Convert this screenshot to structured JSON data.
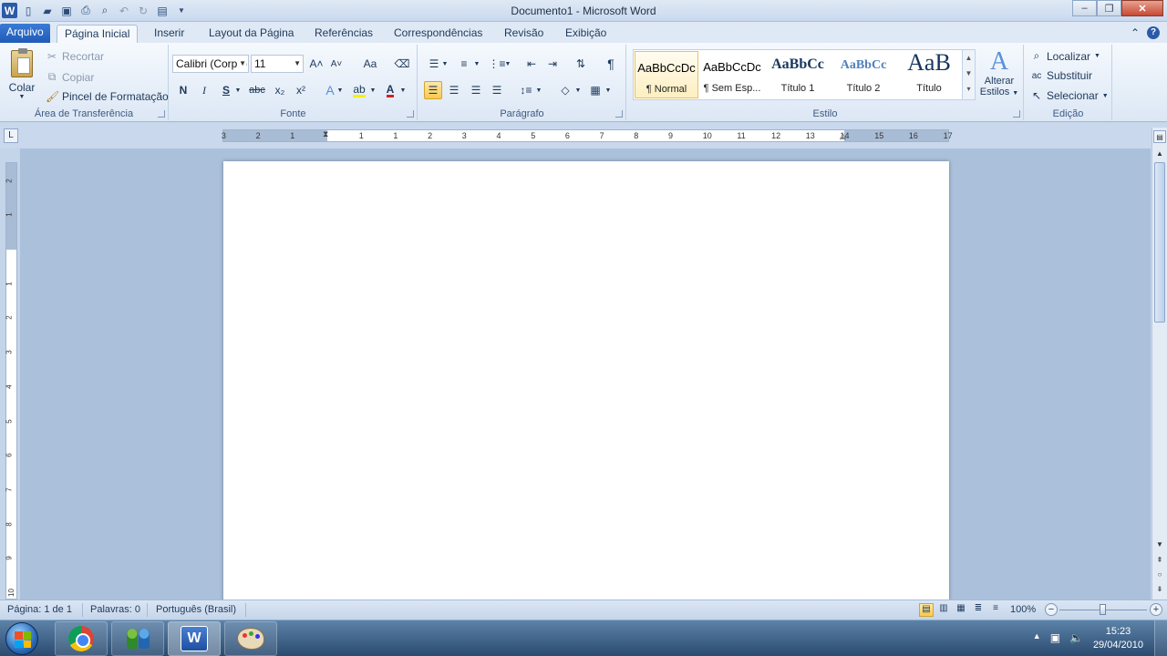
{
  "window": {
    "title": "Documento1  -  Microsoft Word",
    "minimize": "–",
    "restore": "❐",
    "close": "✕"
  },
  "quick_access": {
    "logo": "W",
    "items": [
      "new-document-icon",
      "open-folder-icon",
      "save-as-icon",
      "print-icon",
      "print-preview-icon",
      "undo-icon",
      "redo-icon",
      "save-icon",
      "customize-qat-icon"
    ]
  },
  "tabs": [
    "Arquivo",
    "Página Inicial",
    "Inserir",
    "Layout da Página",
    "Referências",
    "Correspondências",
    "Revisão",
    "Exibição"
  ],
  "active_tab": "Página Inicial",
  "help_label": "?",
  "clipboard": {
    "paste": "Colar",
    "cut": "Recortar",
    "copy": "Copiar",
    "format_painter": "Pincel de Formatação",
    "group_label": "Área de Transferência"
  },
  "font": {
    "family": "Calibri (Corpo)",
    "size": "11",
    "group_label": "Fonte",
    "bold": "N",
    "italic": "I",
    "underline": "S",
    "strikethrough": "abc",
    "subscript": "x₂",
    "superscript": "x²",
    "grow": "A˄",
    "shrink": "A˅",
    "change_case": "Aa",
    "text_color_accent": "#d62020",
    "highlight_accent": "#f8f000"
  },
  "paragraph": {
    "group_label": "Parágrafo",
    "pilcrow": "¶"
  },
  "styles": {
    "group_label": "Estilo",
    "items": [
      {
        "sample": "AaBbCcDc",
        "name": "¶ Normal"
      },
      {
        "sample": "AaBbCcDc",
        "name": "¶ Sem Esp..."
      },
      {
        "sample": "AaBbCc",
        "name": "Título 1"
      },
      {
        "sample": "AaBbCc",
        "name": "Título 2"
      },
      {
        "sample": "AaB",
        "name": "Título"
      }
    ],
    "change_styles_line1": "Alterar",
    "change_styles_line2": "Estilos"
  },
  "editing": {
    "find": "Localizar",
    "replace": "Substituir",
    "select": "Selecionar",
    "group_label": "Edição"
  },
  "ruler": {
    "corner": "L",
    "h_numbers": [
      "3",
      "2",
      "1",
      "1",
      "1",
      "2",
      "3",
      "4",
      "5",
      "6",
      "7",
      "8",
      "9",
      "10",
      "11",
      "12",
      "13",
      "14",
      "15",
      "16",
      "17"
    ],
    "v_numbers": [
      "2",
      "1",
      "1",
      "2",
      "3",
      "4",
      "5",
      "6",
      "7",
      "8",
      "9",
      "10"
    ]
  },
  "status": {
    "page": "Página: 1 de 1",
    "words": "Palavras: 0",
    "language": "Português (Brasil)",
    "zoom": "100%",
    "zoom_minus": "−",
    "zoom_plus": "+",
    "zoom_fraction": 0.5
  },
  "taskbar": {
    "time": "15:23",
    "date": "29/04/2010",
    "word_label": "W"
  }
}
